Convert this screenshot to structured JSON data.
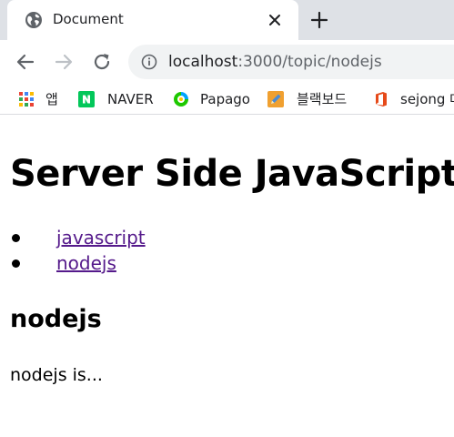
{
  "browser": {
    "tab": {
      "title": "Document",
      "favicon": "globe-icon",
      "close_icon": "close-icon"
    },
    "new_tab_icon": "plus-icon",
    "toolbar": {
      "back_icon": "arrow-left-icon",
      "forward_icon": "arrow-right-icon",
      "reload_icon": "reload-icon",
      "info_icon": "info-icon",
      "url_host": "localhost",
      "url_path": ":3000/topic/nodejs"
    },
    "bookmarks": [
      {
        "label": "앱",
        "icon": "apps-grid-icon"
      },
      {
        "label": "NAVER",
        "icon": "naver-icon"
      },
      {
        "label": "Papago",
        "icon": "papago-icon"
      },
      {
        "label": "블랙보드",
        "icon": "pencil-icon"
      },
      {
        "label": "sejong 대",
        "icon": "office-icon"
      }
    ]
  },
  "page": {
    "title": "Server Side JavaScript",
    "topics": [
      "javascript",
      "nodejs"
    ],
    "heading": "nodejs",
    "description": "nodejs is..."
  },
  "colors": {
    "tabstrip_bg": "#dee1e6",
    "omnibox_bg": "#f1f3f4",
    "visited_link": "#551a8b",
    "naver_green": "#03c75a"
  }
}
